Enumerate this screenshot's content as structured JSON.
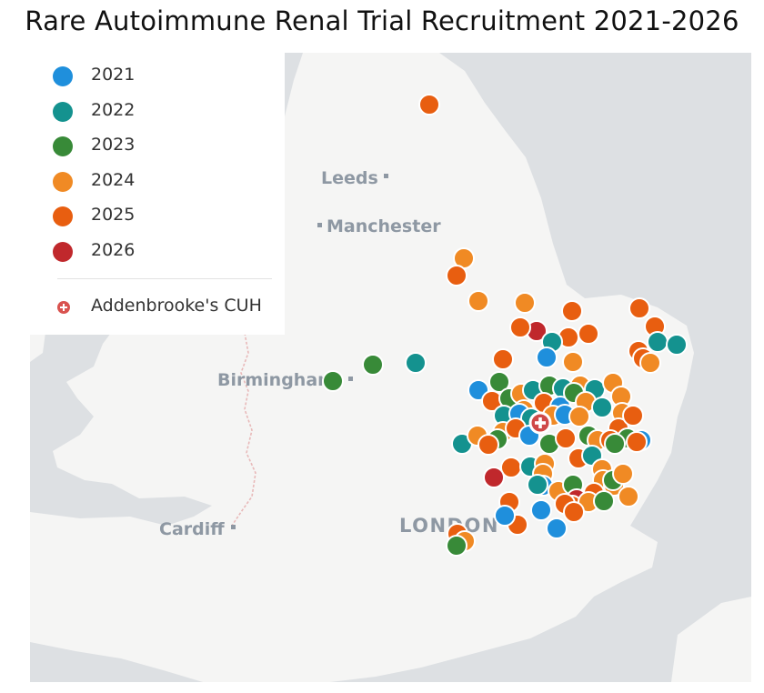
{
  "title": "Rare Autoimmune Renal Trial Recruitment 2021-2026",
  "legend": {
    "years": [
      {
        "label": "2021",
        "color": "#1f8fdc"
      },
      {
        "label": "2022",
        "color": "#14928f"
      },
      {
        "label": "2023",
        "color": "#388a38"
      },
      {
        "label": "2024",
        "color": "#f08a24"
      },
      {
        "label": "2025",
        "color": "#e85e10"
      },
      {
        "label": "2026",
        "color": "#c0282c"
      }
    ],
    "hospital_label": "Addenbrooke's CUH"
  },
  "map": {
    "cities": [
      {
        "name": "Leeds"
      },
      {
        "name": "Manchester"
      },
      {
        "name": "Birmingham"
      },
      {
        "name": "Cardiff"
      },
      {
        "name": "LONDON"
      }
    ]
  },
  "colors": {
    "sea": "#dde0e3",
    "land": "#f5f5f4",
    "border": "#e8b9b9",
    "marker_outline": "#ffffff"
  }
}
